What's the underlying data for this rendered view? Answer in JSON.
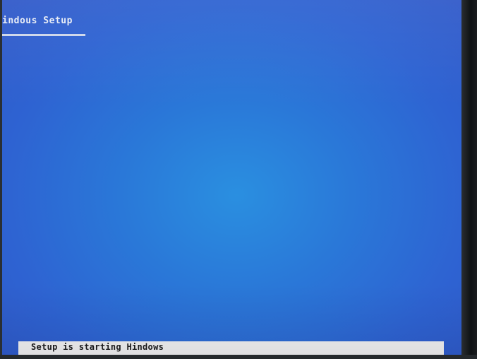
{
  "setup": {
    "title": "indous Setup"
  },
  "status_bar": {
    "text": "Setup is starting Hindows"
  },
  "colors": {
    "screen_blue": "#2e6fd6",
    "status_bar_bg": "#f2f2f2",
    "title_text": "#e7ecf6"
  }
}
